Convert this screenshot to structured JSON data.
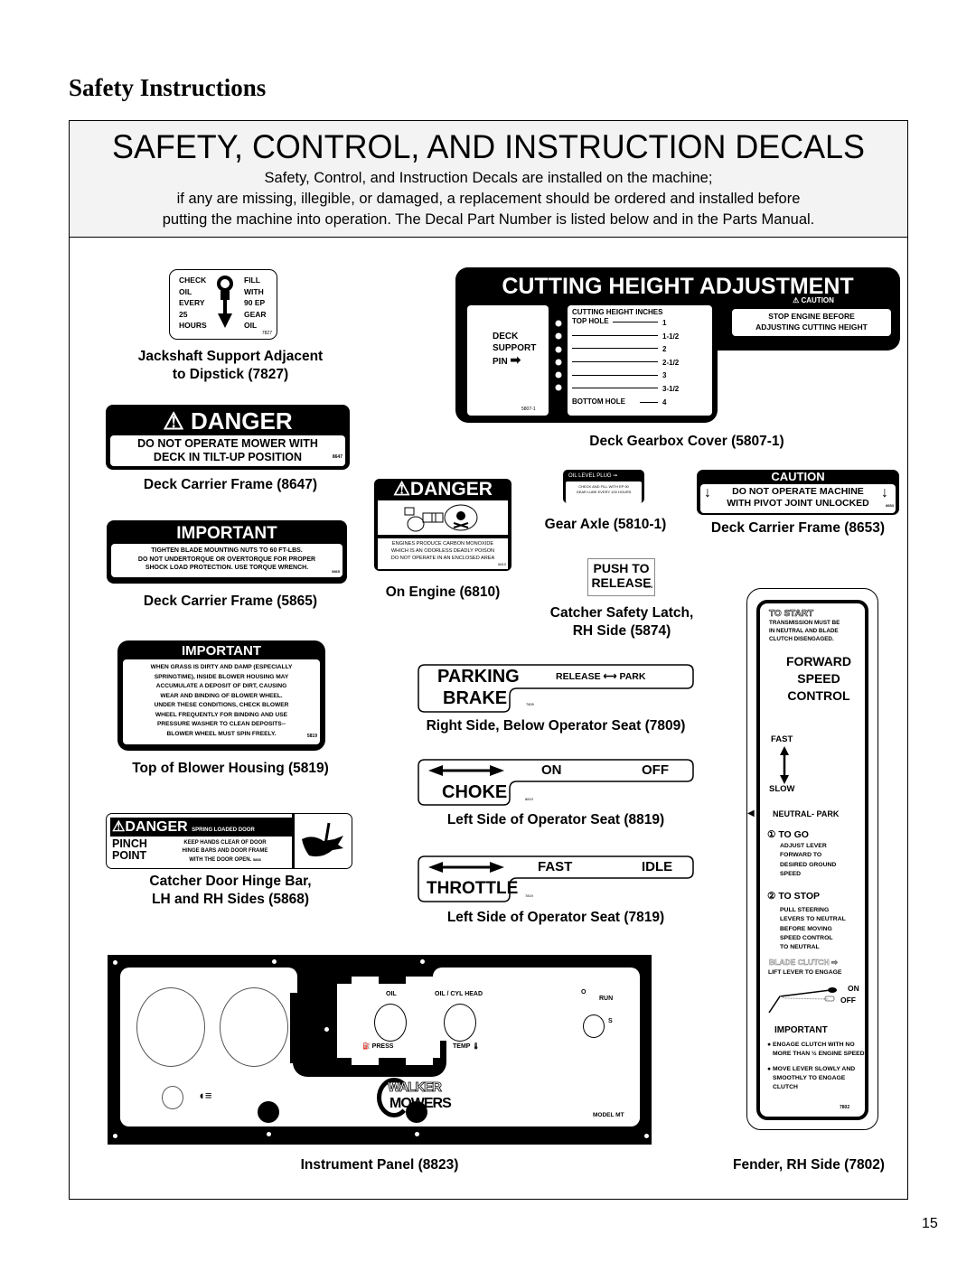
{
  "page": {
    "section_title": "Safety Instructions",
    "page_number": "15"
  },
  "header": {
    "title": "SAFETY, CONTROL, AND INSTRUCTION DECALS",
    "lines": [
      "Safety, Control, and Instruction Decals are installed on the machine;",
      "if any are missing, illegible, or damaged, a replacement should be ordered and installed before",
      "putting the machine into operation.  The Decal Part Number is listed below and in the Parts Manual."
    ]
  },
  "decals": {
    "d7827": {
      "left": [
        "CHECK",
        "OIL",
        "EVERY",
        "25",
        "HOURS"
      ],
      "right": [
        "FILL",
        "WITH",
        "90 EP",
        "GEAR",
        "OIL"
      ],
      "part": "7827",
      "caption1": "Jackshaft Support Adjacent",
      "caption2": "to Dipstick (7827)"
    },
    "d5807": {
      "title": "CUTTING HEIGHT ADJUSTMENT",
      "caution": "CAUTION",
      "caution_text1": "STOP ENGINE BEFORE",
      "caution_text2": "ADJUSTING CUTTING HEIGHT",
      "heading": "CUTTING HEIGHT INCHES",
      "pin1": "DECK",
      "pin2": "SUPPORT",
      "pin3": "PIN",
      "top_hole": "TOP HOLE",
      "bottom_hole": "BOTTOM HOLE",
      "heights": [
        "1",
        "1-1/2",
        "2",
        "2-1/2",
        "3",
        "3-1/2",
        "4"
      ],
      "part": "5807-1",
      "caption": "Deck Gearbox Cover (5807-1)"
    },
    "d8647": {
      "title": "DANGER",
      "line1": "DO NOT OPERATE MOWER WITH",
      "line2": "DECK IN TILT-UP POSITION",
      "part": "8647",
      "caption": "Deck Carrier Frame (8647)"
    },
    "d5865": {
      "title": "IMPORTANT",
      "lines": [
        "TIGHTEN BLADE MOUNTING NUTS TO 60 FT-LBS.",
        "DO NOT UNDERTORQUE OR OVERTORQUE FOR PROPER",
        "SHOCK LOAD PROTECTION. USE TORQUE WRENCH."
      ],
      "part": "5865",
      "caption": "Deck Carrier Frame (5865)"
    },
    "d6810": {
      "title": "DANGER",
      "lines": [
        "ENGINES PRODUCE CARBON MONOXIDE",
        "WHICH IS AN ODORLESS DEADLY POISON",
        "DO NOT OPERATE IN AN ENCLOSED AREA"
      ],
      "part": "6810",
      "caption": "On Engine (6810)"
    },
    "d5810": {
      "title": "OIL LEVEL PLUG",
      "lines": [
        "CHECK AND FILL WITH EP 90",
        "GEAR LUBE EVERY 100 HOURS"
      ],
      "part": "5810-1",
      "caption": "Gear Axle (5810-1)"
    },
    "d8653": {
      "title": "CAUTION",
      "line1": "DO NOT OPERATE MACHINE",
      "line2": "WITH PIVOT JOINT UNLOCKED",
      "part": "8653",
      "caption": "Deck Carrier Frame (8653)"
    },
    "d5874": {
      "line1": "PUSH TO",
      "line2": "RELEASE",
      "part": "5874",
      "caption1": "Catcher Safety Latch,",
      "caption2": "RH Side (5874)"
    },
    "d5819": {
      "title": "IMPORTANT",
      "lines": [
        "WHEN GRASS IS DIRTY AND DAMP (ESPECIALLY",
        "SPRINGTIME), INSIDE BLOWER HOUSING MAY",
        "ACCUMULATE A DEPOSIT OF DIRT, CAUSING",
        "WEAR AND BINDING OF BLOWER WHEEL.",
        "UNDER THESE CONDITIONS, CHECK BLOWER",
        "WHEEL FREQUENTLY FOR BINDING AND USE",
        "PRESSURE WASHER TO CLEAN DEPOSITS--",
        "BLOWER WHEEL MUST SPIN FREELY."
      ],
      "part": "5819",
      "caption": "Top of Blower Housing (5819)"
    },
    "d7809": {
      "line1": "PARKING",
      "line2": "BRAKE",
      "release": "RELEASE",
      "park": "PARK",
      "part": "7809",
      "caption": "Right Side, Below Operator Seat (7809)"
    },
    "d8819": {
      "label": "CHOKE",
      "on": "ON",
      "off": "OFF",
      "part": "8819",
      "caption": "Left Side of Operator Seat (8819)"
    },
    "d7819": {
      "label": "THROTTLE",
      "fast": "FAST",
      "idle": "IDLE",
      "part": "7819",
      "caption": "Left Side of Operator Seat (7819)"
    },
    "d5868": {
      "title": "DANGER",
      "subtitle": "SPRING LOADED DOOR",
      "pinch1": "PINCH",
      "pinch2": "POINT",
      "lines": [
        "KEEP HANDS CLEAR OF DOOR",
        "HINGE BARS AND DOOR FRAME",
        "WITH THE DOOR OPEN."
      ],
      "part": "5868",
      "caption1": "Catcher Door Hinge Bar,",
      "caption2": "LH and RH Sides (5868)"
    },
    "d7802": {
      "to_start": "TO START",
      "start_text": [
        "TRANSMISSION MUST BE",
        "IN NEUTRAL AND BLADE",
        "CLUTCH DISENGAGED."
      ],
      "title": [
        "FORWARD",
        "SPEED",
        "CONTROL"
      ],
      "fast": "FAST",
      "slow": "SLOW",
      "neutral": "NEUTRAL- PARK",
      "to_go": "① TO GO",
      "go_text": [
        "ADJUST LEVER",
        "FORWARD TO",
        "DESIRED GROUND",
        "SPEED"
      ],
      "to_stop": "② TO STOP",
      "stop_text": [
        "PULL STEERING",
        "LEVERS TO NEUTRAL",
        "BEFORE MOVING",
        "SPEED CONTROL",
        "TO NEUTRAL"
      ],
      "blade_clutch": "BLADE CLUTCH ⇨",
      "lift": "LIFT LEVER TO ENGAGE",
      "on": "ON",
      "off": "OFF",
      "important": "IMPORTANT",
      "bullets": [
        "ENGAGE CLUTCH WITH NO MORE THAN ½ ENGINE SPEED",
        "MOVE LEVER SLOWLY AND SMOOTHLY TO ENGAGE CLUTCH"
      ],
      "part": "7802",
      "caption": "Fender, RH Side (7802)"
    },
    "d8823": {
      "oil": "OIL",
      "press": "PRESS",
      "cyl_head": "OIL / CYL HEAD",
      "temp": "TEMP",
      "key_o": "O",
      "key_run": "RUN",
      "key_s": "S",
      "logo1": "WALKER",
      "logo2": "MOWERS",
      "model": "MODEL MT",
      "caption": "Instrument Panel (8823)"
    }
  }
}
